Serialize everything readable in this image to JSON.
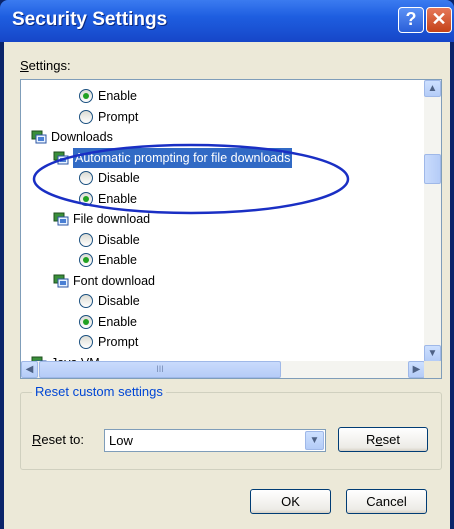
{
  "window": {
    "title": "Security Settings",
    "help_glyph": "?",
    "close_glyph": "✕"
  },
  "settings_label": "Settings:",
  "settings_label_mnemonic": "S",
  "settings_label_rest": "ettings:",
  "tree": [
    {
      "kind": "radio",
      "label": "Enable",
      "checked": true
    },
    {
      "kind": "radio",
      "label": "Prompt",
      "checked": false
    },
    {
      "kind": "category",
      "label": "Downloads"
    },
    {
      "kind": "setting",
      "label": "Automatic prompting for file downloads",
      "selected": true
    },
    {
      "kind": "radio",
      "label": "Disable",
      "checked": false
    },
    {
      "kind": "radio",
      "label": "Enable",
      "checked": true
    },
    {
      "kind": "setting",
      "label": "File download"
    },
    {
      "kind": "radio",
      "label": "Disable",
      "checked": false
    },
    {
      "kind": "radio",
      "label": "Enable",
      "checked": true
    },
    {
      "kind": "setting",
      "label": "Font download"
    },
    {
      "kind": "radio",
      "label": "Disable",
      "checked": false
    },
    {
      "kind": "radio",
      "label": "Enable",
      "checked": true
    },
    {
      "kind": "radio",
      "label": "Prompt",
      "checked": false
    },
    {
      "kind": "category",
      "label": "Java VM"
    }
  ],
  "scrollbar": {
    "up_glyph": "▲",
    "down_glyph": "▼",
    "left_glyph": "◀",
    "right_glyph": "▶",
    "grip_glyph": "III"
  },
  "reset_group": {
    "title": "Reset custom settings",
    "reset_to_mnemonic": "R",
    "reset_to_rest": "eset to:",
    "selected_value": "Low",
    "dropdown_glyph": "▼",
    "reset_button_pre": "R",
    "reset_button_mnemonic": "e",
    "reset_button_post": "set"
  },
  "buttons": {
    "ok": "OK",
    "cancel": "Cancel"
  },
  "colors": {
    "title_blue": "#1e5ee0",
    "selection": "#316ac5",
    "highlight_ellipse": "#1a2fc4",
    "radio_green": "#21a121"
  }
}
